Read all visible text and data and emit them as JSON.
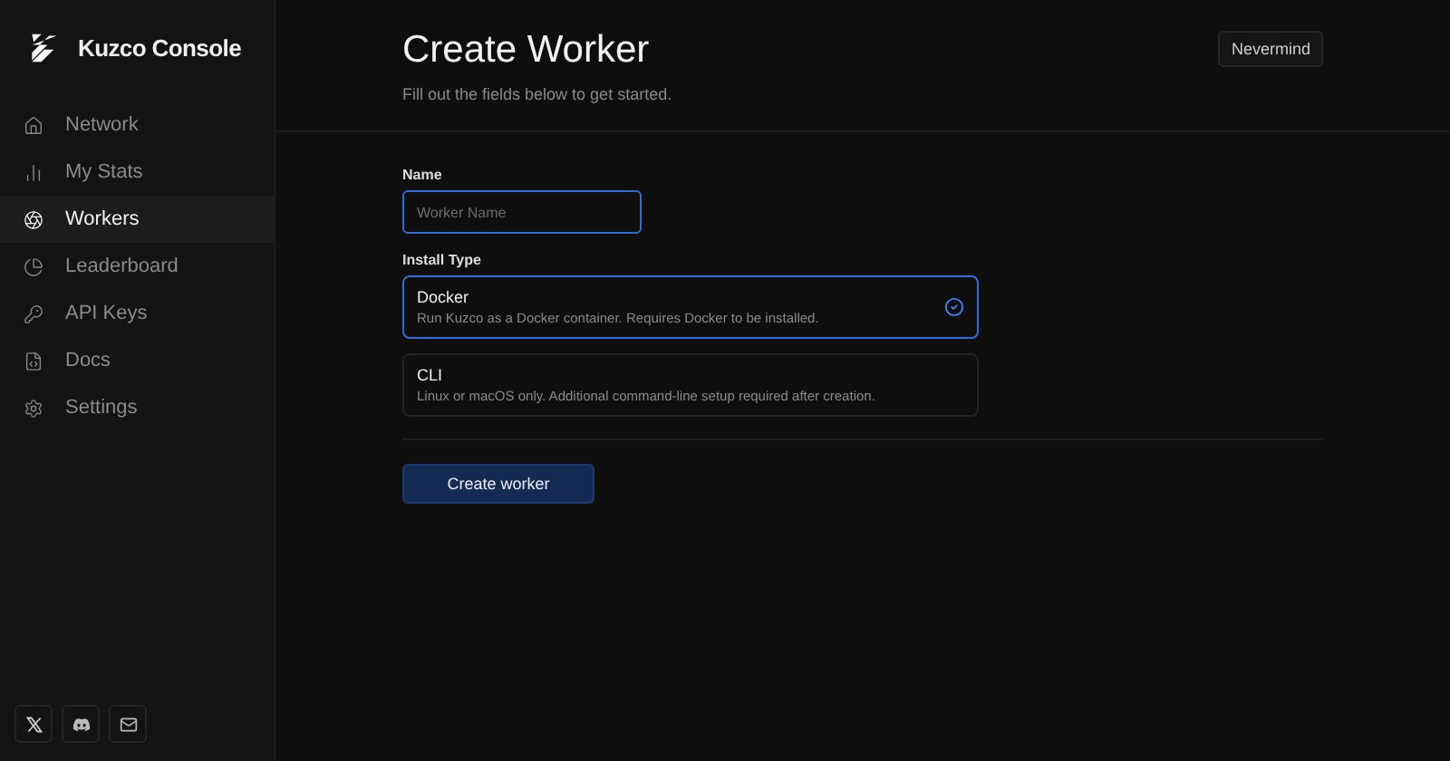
{
  "brand": {
    "name": "Kuzco Console"
  },
  "nav": [
    {
      "label": "Network",
      "selected": false
    },
    {
      "label": "My Stats",
      "selected": false
    },
    {
      "label": "Workers",
      "selected": true
    },
    {
      "label": "Leaderboard",
      "selected": false
    },
    {
      "label": "API Keys",
      "selected": false
    },
    {
      "label": "Docs",
      "selected": false
    },
    {
      "label": "Settings",
      "selected": false
    }
  ],
  "header": {
    "title": "Create Worker",
    "subtitle": "Fill out the fields below to get started.",
    "cancel": "Nevermind"
  },
  "name_field": {
    "label": "Name",
    "placeholder": "Worker Name"
  },
  "install_type": {
    "label": "Install Type",
    "options": [
      {
        "title": "Docker",
        "description": "Run Kuzco as a Docker container. Requires Docker to be installed.",
        "selected": true
      },
      {
        "title": "CLI",
        "description": "Linux or macOS only. Additional command-line setup required after creation.",
        "selected": false
      }
    ]
  },
  "submit": "Create worker"
}
